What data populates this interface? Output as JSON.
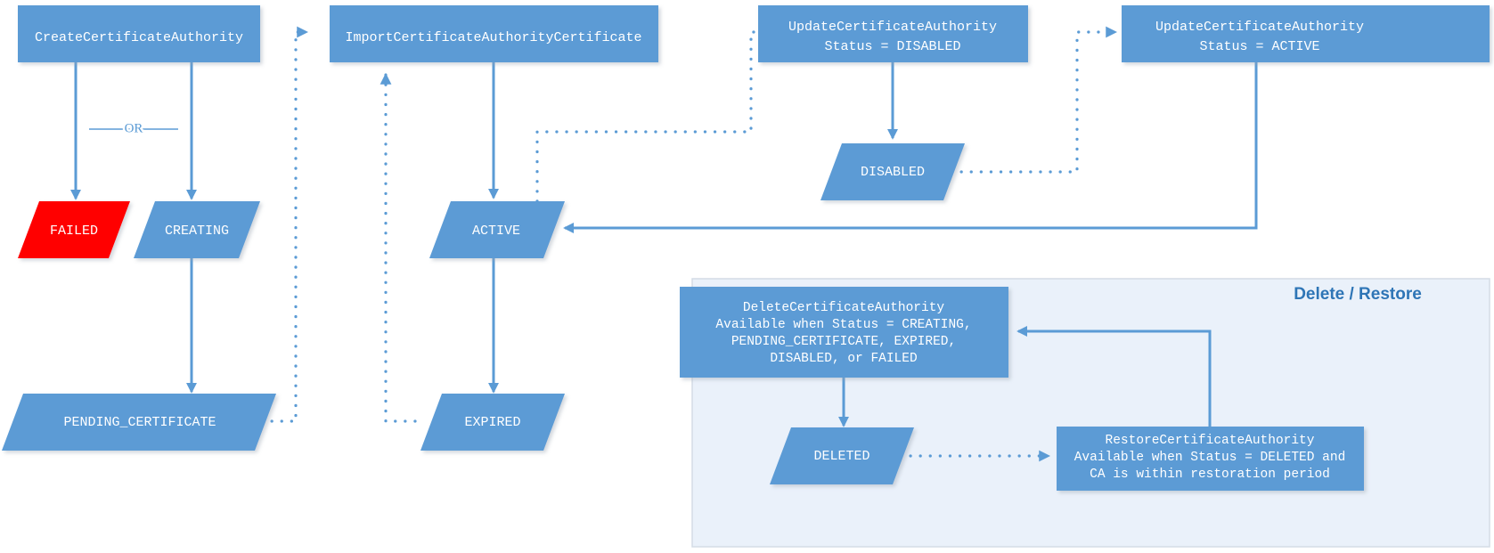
{
  "diagram": {
    "title": "AWS Private CA Certificate Authority lifecycle state diagram",
    "colors": {
      "node_blue": "#5B9BD5",
      "failed_red": "#FF0000",
      "panel_background": "#EAF1FA",
      "panel_border": "#D4DCE6",
      "group_title": "#2E75B6",
      "edge": "#5B9BD5",
      "node_label": "#FFFFFF"
    },
    "operations": {
      "create_ca": "CreateCertificateAuthority",
      "import_ca_cert": "ImportCertificateAuthorityCertificate",
      "update_ca_disabled_line1": "UpdateCertificateAuthority",
      "update_ca_disabled_line2": "Status = DISABLED",
      "update_ca_active_line1": "UpdateCertificateAuthority",
      "update_ca_active_line2": "Status = ACTIVE",
      "delete_ca_line1": "DeleteCertificateAuthority",
      "delete_ca_line2": "Available when Status = CREATING,",
      "delete_ca_line3": "PENDING_CERTIFICATE, EXPIRED,",
      "delete_ca_line4": "DISABLED, or FAILED",
      "restore_ca_line1": "RestoreCertificateAuthority",
      "restore_ca_line2": "Available when Status = DELETED and",
      "restore_ca_line3": "CA is within restoration period"
    },
    "states": {
      "failed": "FAILED",
      "creating": "CREATING",
      "pending_certificate": "PENDING_CERTIFICATE",
      "active": "ACTIVE",
      "expired": "EXPIRED",
      "disabled": "DISABLED",
      "deleted": "DELETED"
    },
    "labels": {
      "or": "OR",
      "delete_restore_group": "Delete / Restore"
    }
  }
}
